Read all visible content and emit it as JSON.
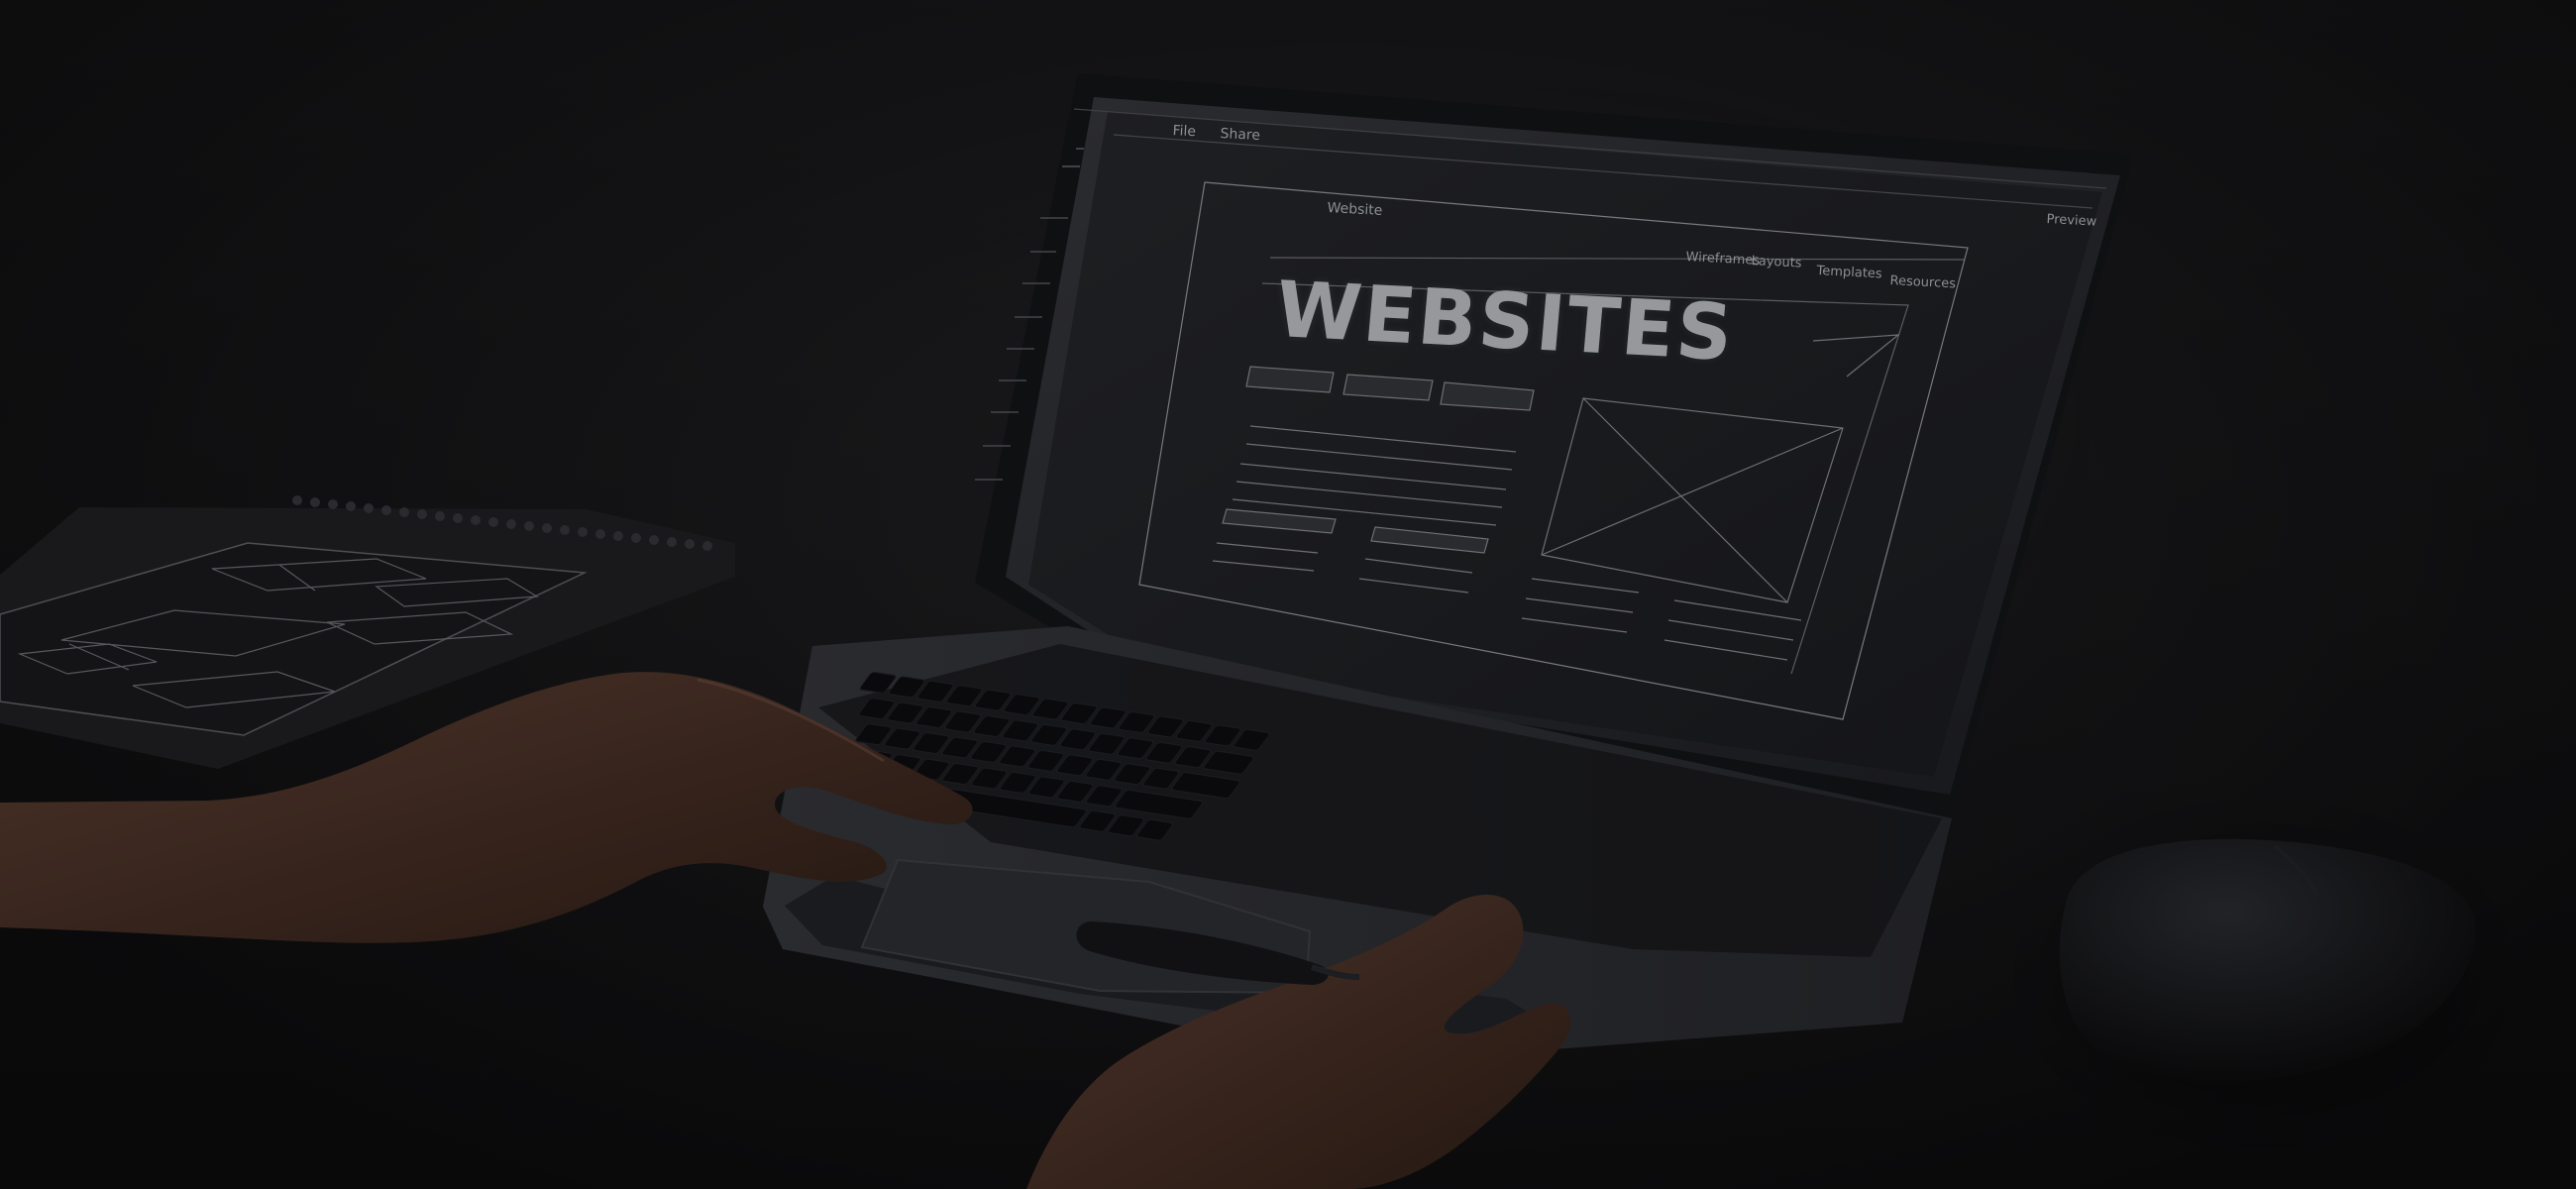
{
  "screen": {
    "app_menu": [
      "File",
      "Share"
    ],
    "browser_tab": "Website",
    "top_right_link": "Preview",
    "nav_links": [
      "Wireframes",
      "Layouts",
      "Templates",
      "Resources"
    ],
    "headline": "WEBSITES"
  },
  "colors": {
    "background": "#0b0b0c",
    "screen": "#1b1c1f",
    "wireframe": "#7b7d81",
    "skin": "#3c2c24"
  }
}
